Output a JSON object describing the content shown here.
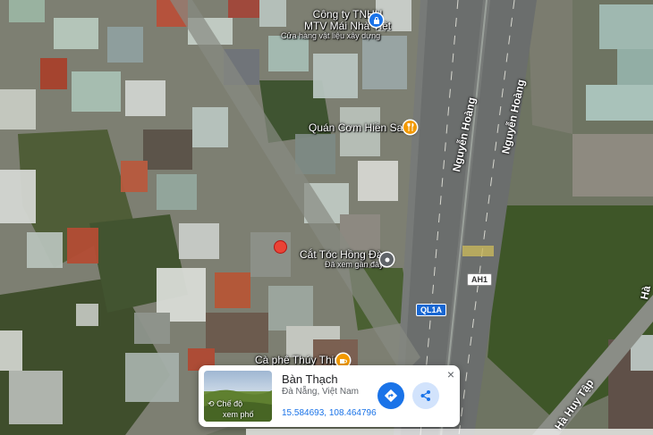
{
  "map": {
    "pois": [
      {
        "name": "Công ty TNHH",
        "name2": "MTV Mái Nhà Việt",
        "subtitle": "Cửa hàng vật liệu xây dựng",
        "icon": "shopping-bag-icon"
      },
      {
        "name": "Quán Cơm Hiền Sang",
        "icon": "restaurant-icon"
      },
      {
        "name": "Cắt Tóc Hồng Đào",
        "subtitle": "Đã xem gần đây",
        "icon": "recent-place-icon"
      },
      {
        "name": "Cà phê Thúy Thịnh",
        "icon": "coffee-icon"
      }
    ],
    "roads": [
      "Nguyễn Hoàng",
      "Nguyễn Hoàng",
      "Hà Huy Tập",
      "Hà"
    ],
    "shields": [
      "AH1",
      "QL1A"
    ],
    "selected_marker_color": "#ea4335"
  },
  "card": {
    "place_name": "Bàn Thạch",
    "region": "Đà Nẵng, Việt Nam",
    "coordinates": "15.584693, 108.464796",
    "thumbnail_label_1": "Chế độ",
    "thumbnail_label_2": "xem phố",
    "thumbnail_icon": "street-view-icon",
    "directions_icon": "directions-icon",
    "share_icon": "share-icon",
    "close_label": "×",
    "accent": "#1a73e8"
  }
}
